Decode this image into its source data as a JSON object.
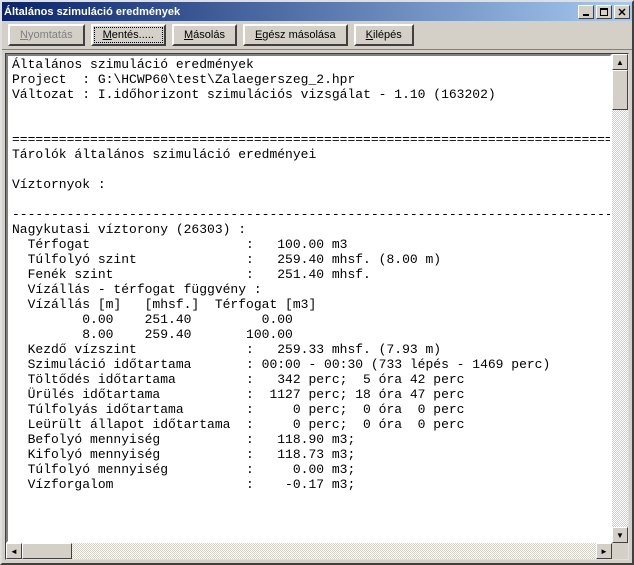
{
  "titlebar": {
    "title": "Általános szimuláció eredmények"
  },
  "toolbar": {
    "print": "Nyomtatás",
    "save": "Mentés.....",
    "copy": "Másolás",
    "copyall": "Egész másolása",
    "exit": "Kilépés"
  },
  "mnemonics": {
    "print": "N",
    "save": "M",
    "copy": "M",
    "copyall": "E",
    "exit": "K"
  },
  "report": {
    "title": "Általános szimuláció eredmények",
    "project_label": "Project  :",
    "project_value": "G:\\HCWP60\\test\\Zalaegerszeg_2.hpr",
    "variant_label": "Változat :",
    "variant_value": "I.időhorizont szimulációs vizsgálat - 1.10 (163202)",
    "sep": "==============================================================================",
    "dash": "------------------------------------------------------------------------------",
    "section1": "Tárolók általános szimuláció eredményei",
    "section2": "Víztornyok :",
    "tower_header": "Nagykutasi víztorony (26303) :",
    "rows": {
      "terfogat": "  Térfogat                    :   100.00 m3",
      "tulfolyo": "  Túlfolyó szint              :   259.40 mhsf. (8.00 m)",
      "fenek": "  Fenék szint                 :   251.40 mhsf.",
      "vizallas_hdr": "  Vízállás - térfogat függvény :",
      "table_hdr": "  Vízállás [m]   [mhsf.]  Térfogat [m3]",
      "row1": "         0.00    251.40         0.00",
      "row2": "         8.00    259.40       100.00",
      "kezdo": "  Kezdő vízszint              :   259.33 mhsf. (7.93 m)",
      "szim": "  Szimuláció időtartama       : 00:00 - 00:30 (733 lépés - 1469 perc)",
      "toltodes": "  Töltődés időtartama         :   342 perc;  5 óra 42 perc",
      "urules": "  Ürülés időtartama           :  1127 perc; 18 óra 47 perc",
      "tulfolyas": "  Túlfolyás időtartama        :     0 perc;  0 óra  0 perc",
      "leurult": "  Leürült állapot időtartama  :     0 perc;  0 óra  0 perc",
      "befolyo": "  Befolyó mennyiség           :   118.90 m3;",
      "kifolyo": "  Kifolyó mennyiség           :   118.73 m3;",
      "tulfolyom": "  Túlfolyó mennyiség          :     0.00 m3;",
      "vizforg": "  Vízforgalom                 :    -0.17 m3;"
    }
  }
}
